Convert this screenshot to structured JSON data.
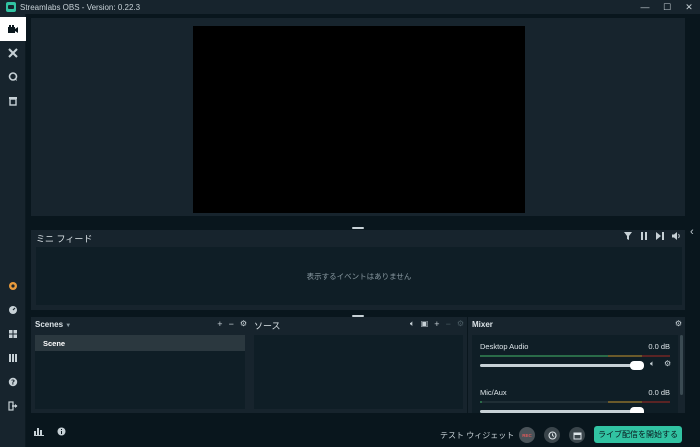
{
  "window": {
    "title": "Streamlabs OBS - Version: 0.22.3",
    "controls": [
      "—",
      "☐",
      "✕"
    ]
  },
  "sidebar": {
    "top_items": [
      {
        "name": "editor",
        "icon": "camera-icon"
      },
      {
        "name": "themes",
        "icon": "tools-icon"
      },
      {
        "name": "chatbot",
        "icon": "chat-bubble-icon"
      },
      {
        "name": "store",
        "icon": "store-icon"
      }
    ],
    "bottom_items": [
      {
        "name": "prime",
        "icon": "badge-icon"
      },
      {
        "name": "dashboard",
        "icon": "gauge-icon"
      },
      {
        "name": "layout",
        "icon": "grid-icon"
      },
      {
        "name": "studio-mode",
        "icon": "columns-icon"
      },
      {
        "name": "help",
        "icon": "help-icon"
      },
      {
        "name": "logout",
        "icon": "logout-icon"
      }
    ]
  },
  "mini_feed": {
    "title": "ミニ フィード",
    "empty_text": "表示するイベントはありません"
  },
  "scenes": {
    "title": "Scenes",
    "items": [
      "Scene"
    ]
  },
  "sources": {
    "title": "ソース"
  },
  "mixer": {
    "title": "Mixer",
    "items": [
      {
        "name": "Desktop Audio",
        "db": "0.0 dB"
      },
      {
        "name": "Mic/Aux",
        "db": "0.0 dB"
      }
    ]
  },
  "footer": {
    "test_widget": "テスト ウィジェット",
    "rec_label": "REC",
    "go_live": "ライブ配信を開始する"
  },
  "colors": {
    "accent": "#31c3a2",
    "background": "#09161d",
    "panel": "#17242d"
  }
}
